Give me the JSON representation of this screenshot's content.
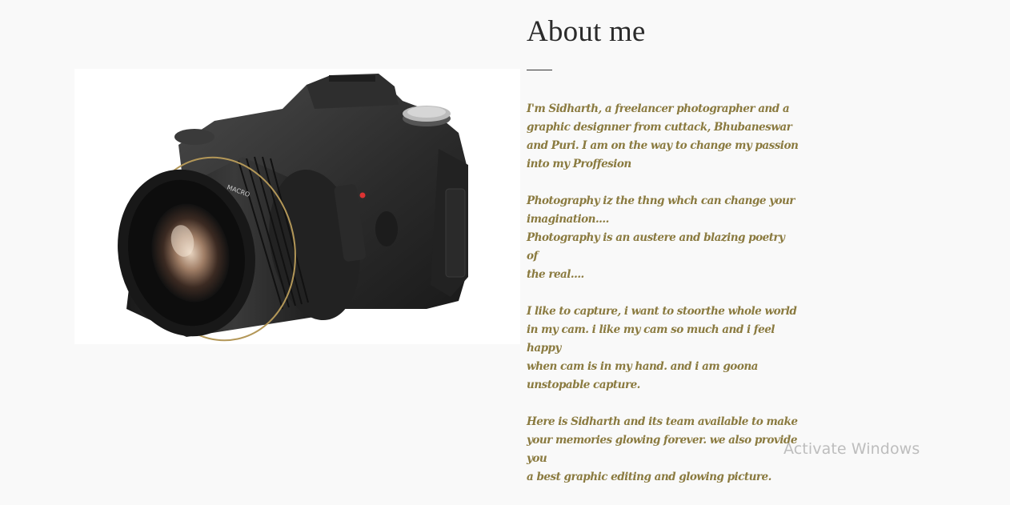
{
  "about": {
    "title": "About me",
    "paragraphs": [
      "I'm Sidharth, a freelancer photographer and a\ngraphic designner from cuttack, Bhubaneswar\nand Puri. I am on the way to change my passion\ninto my Proffesion",
      "Photography iz the thng whch can change your\nimagination....\nPhotography is an austere and blazing poetry of\nthe real....",
      "I like to capture, i want to stoorthe whole world\nin my cam. i like my cam so much and i feel happy\nwhen cam is in my hand. and i am goona\nunstopable capture.",
      "Here is Sidharth and its team available to make\nyour memories glowing forever. we also provide you\na best graphic editing and glowing picture."
    ]
  },
  "photo": {
    "icon": "camera-photo",
    "lens_text": "MACRO"
  },
  "watermark": {
    "text": "Activate Windows"
  }
}
